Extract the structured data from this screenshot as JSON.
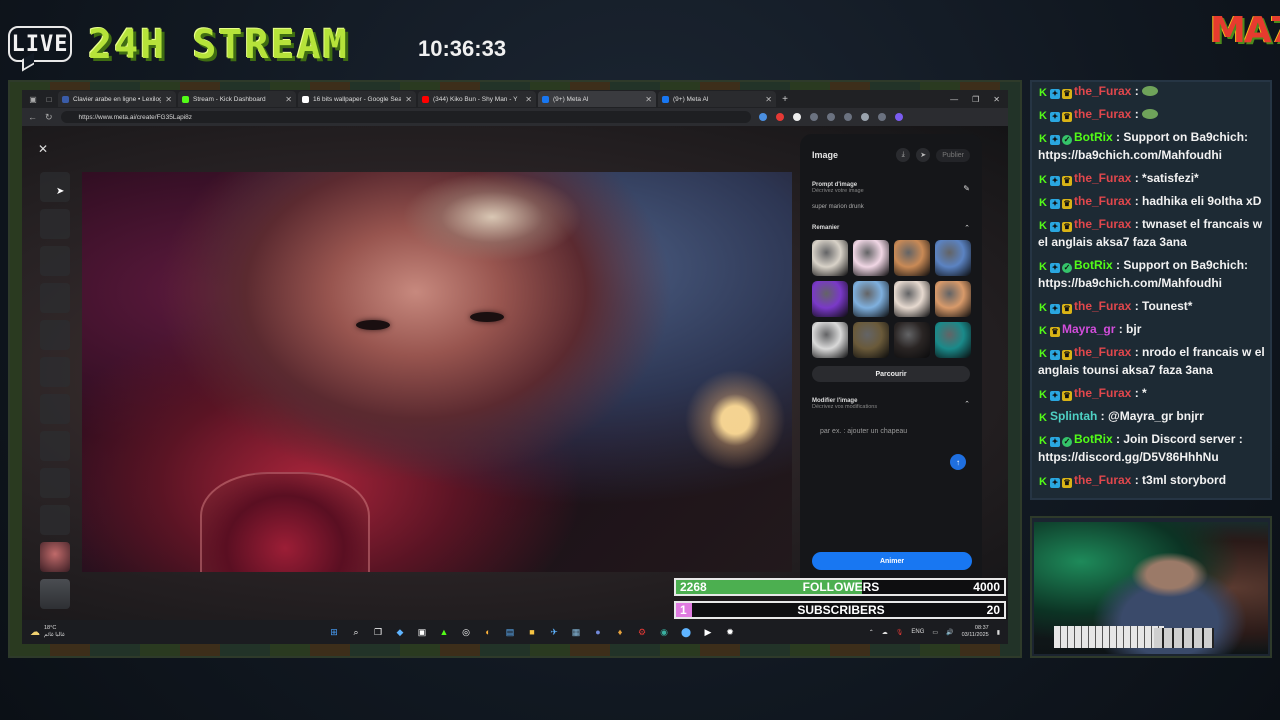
{
  "overlay": {
    "live_label": "LIVE",
    "stream_title": "24H STREAM",
    "clock": "10:36:33",
    "logo_text": "MA7"
  },
  "browser": {
    "tabs": [
      {
        "label": "Clavier arabe en ligne • Lexilogos",
        "favicon_color": "#3a5ca8",
        "active": false
      },
      {
        "label": "Stream - Kick Dashboard",
        "favicon_color": "#53fc18",
        "active": false
      },
      {
        "label": "16 bits wallpaper - Google Search",
        "favicon_color": "#ffffff",
        "active": false
      },
      {
        "label": "(344) Kiko Bun - Shy Man - Y",
        "favicon_color": "#ff0000",
        "active": false
      },
      {
        "label": "(9+) Meta AI",
        "favicon_color": "#1877f2",
        "active": true
      },
      {
        "label": "(9+) Meta AI",
        "favicon_color": "#1877f2",
        "active": false
      }
    ],
    "url": "https://www.meta.ai/create/FG35Lapi8z"
  },
  "panel": {
    "title": "Image",
    "publish_label": "Publier",
    "prompt_title": "Prompt d'image",
    "prompt_sub": "Décrivez votre image",
    "prompt_value": "super marion drunk",
    "remix_title": "Remanier",
    "swatch_colors": [
      "#d8d2c8",
      "#f0d6e4",
      "#c98a56",
      "#5b83c2",
      "#7a39c8",
      "#7fb0de",
      "#e6d9cf",
      "#d89a6a",
      "#d9d9d9",
      "#6a5a3a",
      "#2a2524",
      "#1a8a8a"
    ],
    "browse_label": "Parcourir",
    "modify_title": "Modifier l'image",
    "modify_sub": "Décrivez vos modifications",
    "modify_placeholder": "par ex. : ajouter un chapeau",
    "animate_label": "Animer",
    "watermark": "...on personnalisée"
  },
  "taskbar": {
    "temp": "18°C",
    "weather_text": "غالبا غائم",
    "lang": "ENG",
    "time": "08:37",
    "date": "03/11/2025"
  },
  "goals": {
    "followers": {
      "current": "2268",
      "label": "FOLLOWERS",
      "target": "4000",
      "progress": 0.567,
      "color": "#4caf50"
    },
    "subscribers": {
      "current": "1",
      "label": "SUBSCRIBERS",
      "target": "20",
      "progress": 0.05,
      "color": "#e07be0"
    }
  },
  "chat": [
    {
      "user": "the_Furax",
      "color": "#e0474c",
      "badges": [
        "k",
        "sub",
        "vip"
      ],
      "text": "",
      "emote": true
    },
    {
      "user": "the_Furax",
      "color": "#e0474c",
      "badges": [
        "k",
        "sub",
        "vip"
      ],
      "text": "",
      "emote": true
    },
    {
      "user": "BotRix",
      "color": "#53fc18",
      "badges": [
        "k",
        "sub",
        "bot"
      ],
      "text": "Support on Ba9chich: https://ba9chich.com/Mahfoudhi",
      "emote": false
    },
    {
      "user": "the_Furax",
      "color": "#e0474c",
      "badges": [
        "k",
        "sub",
        "vip"
      ],
      "text": "*satisfezi*",
      "emote": false
    },
    {
      "user": "the_Furax",
      "color": "#e0474c",
      "badges": [
        "k",
        "sub",
        "vip"
      ],
      "text": "hadhika eli 9oltha xD",
      "emote": false
    },
    {
      "user": "the_Furax",
      "color": "#e0474c",
      "badges": [
        "k",
        "sub",
        "vip"
      ],
      "text": "twnaset el francais w el anglais aksa7 faza 3ana",
      "emote": false
    },
    {
      "user": "BotRix",
      "color": "#53fc18",
      "badges": [
        "k",
        "sub",
        "bot"
      ],
      "text": "Support on Ba9chich: https://ba9chich.com/Mahfoudhi",
      "emote": false
    },
    {
      "user": "the_Furax",
      "color": "#e0474c",
      "badges": [
        "k",
        "sub",
        "vip"
      ],
      "text": "Tounest*",
      "emote": false
    },
    {
      "user": "Mayra_gr",
      "color": "#d24ddb",
      "badges": [
        "k",
        "vip"
      ],
      "text": "bjr",
      "emote": false
    },
    {
      "user": "the_Furax",
      "color": "#e0474c",
      "badges": [
        "k",
        "sub",
        "vip"
      ],
      "text": "nrodo el francais w el anglais tounsi aksa7 faza 3ana",
      "emote": false
    },
    {
      "user": "the_Furax",
      "color": "#e0474c",
      "badges": [
        "k",
        "sub",
        "vip"
      ],
      "text": "*",
      "emote": false
    },
    {
      "user": "Splintah",
      "color": "#4fd1c5",
      "badges": [
        "k"
      ],
      "text": "@Mayra_gr bnjrr",
      "emote": false
    },
    {
      "user": "BotRix",
      "color": "#53fc18",
      "badges": [
        "k",
        "sub",
        "bot"
      ],
      "text": "Join Discord server : https://discord.gg/D5V86HhhNu",
      "emote": false
    },
    {
      "user": "the_Furax",
      "color": "#e0474c",
      "badges": [
        "k",
        "sub",
        "vip"
      ],
      "text": "t3ml storybord",
      "emote": false
    }
  ]
}
